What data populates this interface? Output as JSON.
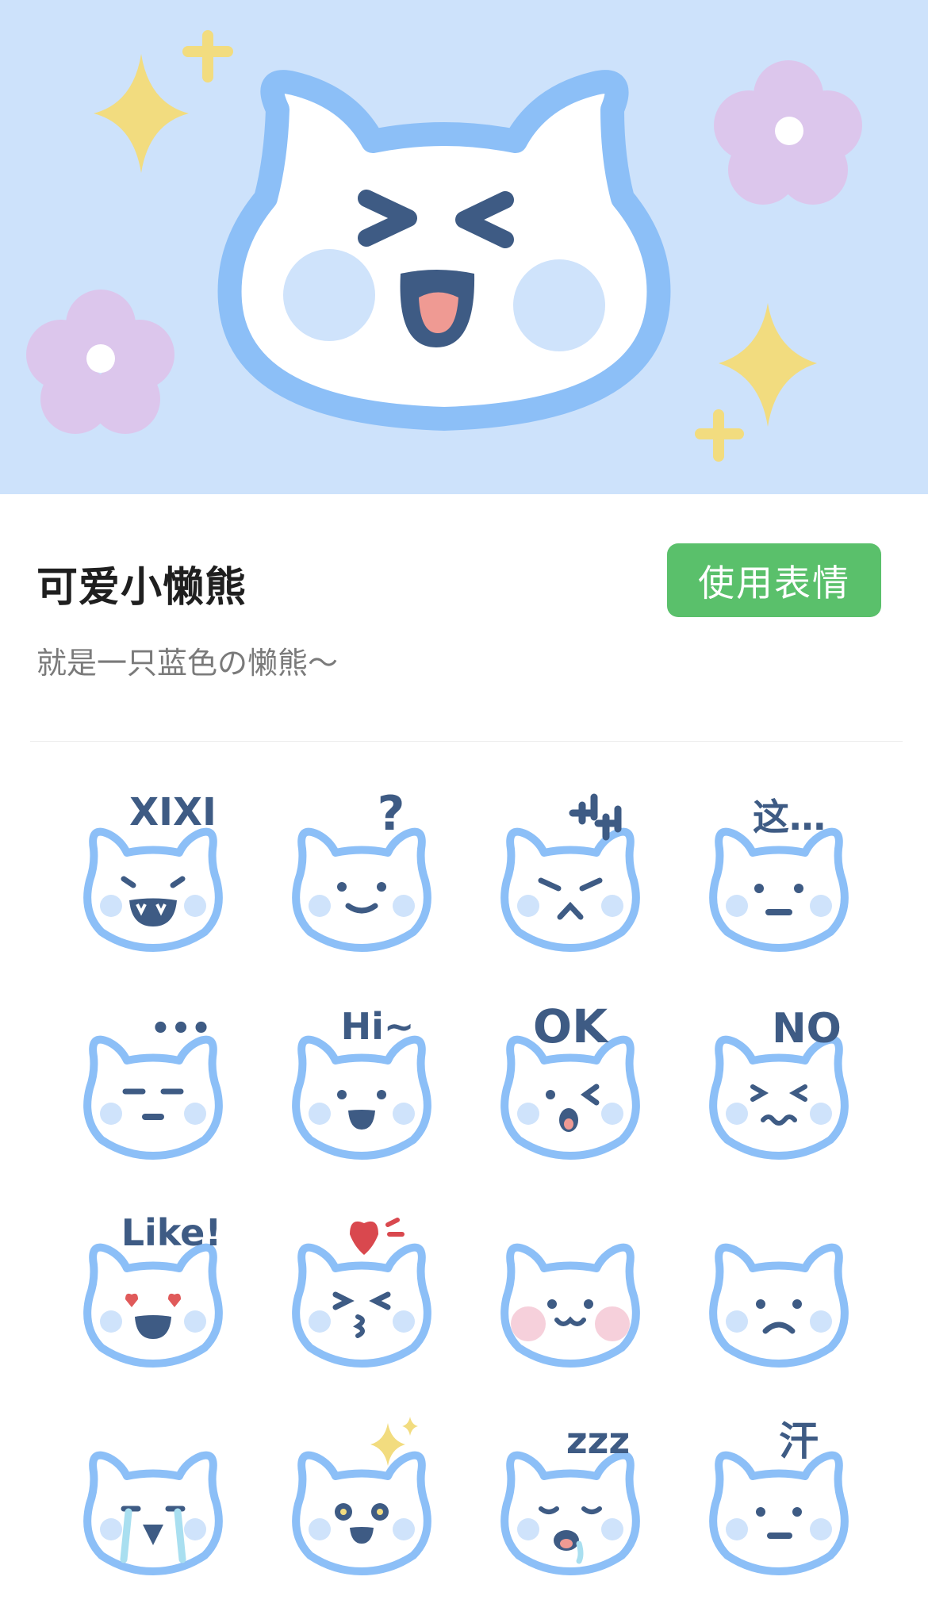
{
  "pack": {
    "title": "可爱小懒熊",
    "description": "就是一只蓝色の懒熊～",
    "use_button_label": "使用表情"
  },
  "colors": {
    "banner_bg": "#cde2fb",
    "bear_outline": "#8cbff7",
    "cheek": "#cfe3fb",
    "accent_green": "#5ac06b",
    "sparkle": "#f2dc7f",
    "flower": "#dcc6ec",
    "ink": "#3e5b84"
  },
  "stickers": [
    {
      "caption": "XIXI",
      "expression": "grin"
    },
    {
      "caption": "?",
      "expression": "smile"
    },
    {
      "caption": "",
      "expression": "angry",
      "icon": "anger-mark-icon"
    },
    {
      "caption": "这…",
      "expression": "flat"
    },
    {
      "caption": "•••",
      "expression": "unamused"
    },
    {
      "caption": "Hi~",
      "expression": "happy"
    },
    {
      "caption": "OK",
      "expression": "wink"
    },
    {
      "caption": "NO",
      "expression": "squeeze"
    },
    {
      "caption": "Like!",
      "expression": "heart-eyes"
    },
    {
      "caption": "",
      "expression": "kiss",
      "icon": "heart-icon"
    },
    {
      "caption": "",
      "expression": "blush"
    },
    {
      "caption": "",
      "expression": "sad"
    },
    {
      "caption": "",
      "expression": "cry"
    },
    {
      "caption": "",
      "expression": "starry",
      "icon": "sparkle-icon"
    },
    {
      "caption": "zzz",
      "expression": "sleep"
    },
    {
      "caption": "汗",
      "expression": "sweat"
    }
  ]
}
